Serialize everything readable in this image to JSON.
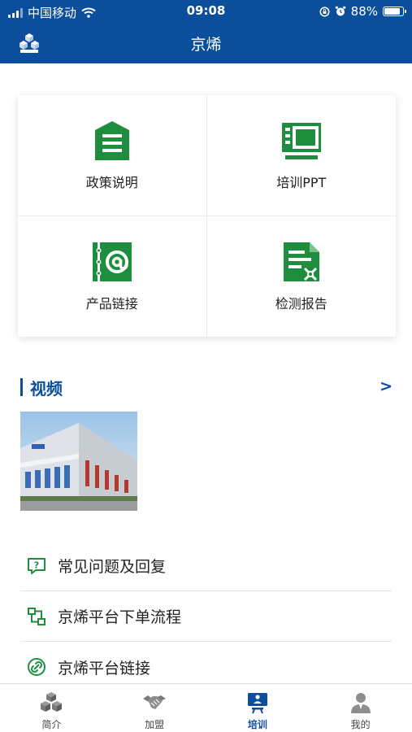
{
  "status_bar": {
    "carrier": "中国移动",
    "time": "09:08",
    "battery_percent_text": "88%",
    "battery_level": 0.88,
    "icons": [
      "signal-icon",
      "wifi-icon",
      "screen-lock-icon",
      "alarm-icon",
      "battery-icon"
    ]
  },
  "nav": {
    "title": "京烯",
    "logo_icon": "brand-logo-icon"
  },
  "menu_tiles": [
    {
      "label": "政策说明",
      "icon": "policy-document-icon"
    },
    {
      "label": "培训PPT",
      "icon": "presentation-icon"
    },
    {
      "label": "产品链接",
      "icon": "address-book-icon"
    },
    {
      "label": "检测报告",
      "icon": "report-document-icon"
    }
  ],
  "video_section": {
    "title": "视频",
    "more": ">"
  },
  "links": [
    {
      "label": "常见问题及回复",
      "icon": "faq-icon"
    },
    {
      "label": "京烯平台下单流程",
      "icon": "flowchart-icon"
    },
    {
      "label": "京烯平台链接",
      "icon": "link-icon"
    }
  ],
  "tabbar": {
    "active": "培训",
    "tabs": [
      {
        "label": "简介",
        "icon": "cubes-icon"
      },
      {
        "label": "加盟",
        "icon": "handshake-icon"
      },
      {
        "label": "培训",
        "icon": "training-board-icon"
      },
      {
        "label": "我的",
        "icon": "user-icon"
      }
    ]
  },
  "colors": {
    "primary": "#0b4f9c",
    "icon_green": "#1e8e3e",
    "tab_gray": "#8a8a8a"
  }
}
